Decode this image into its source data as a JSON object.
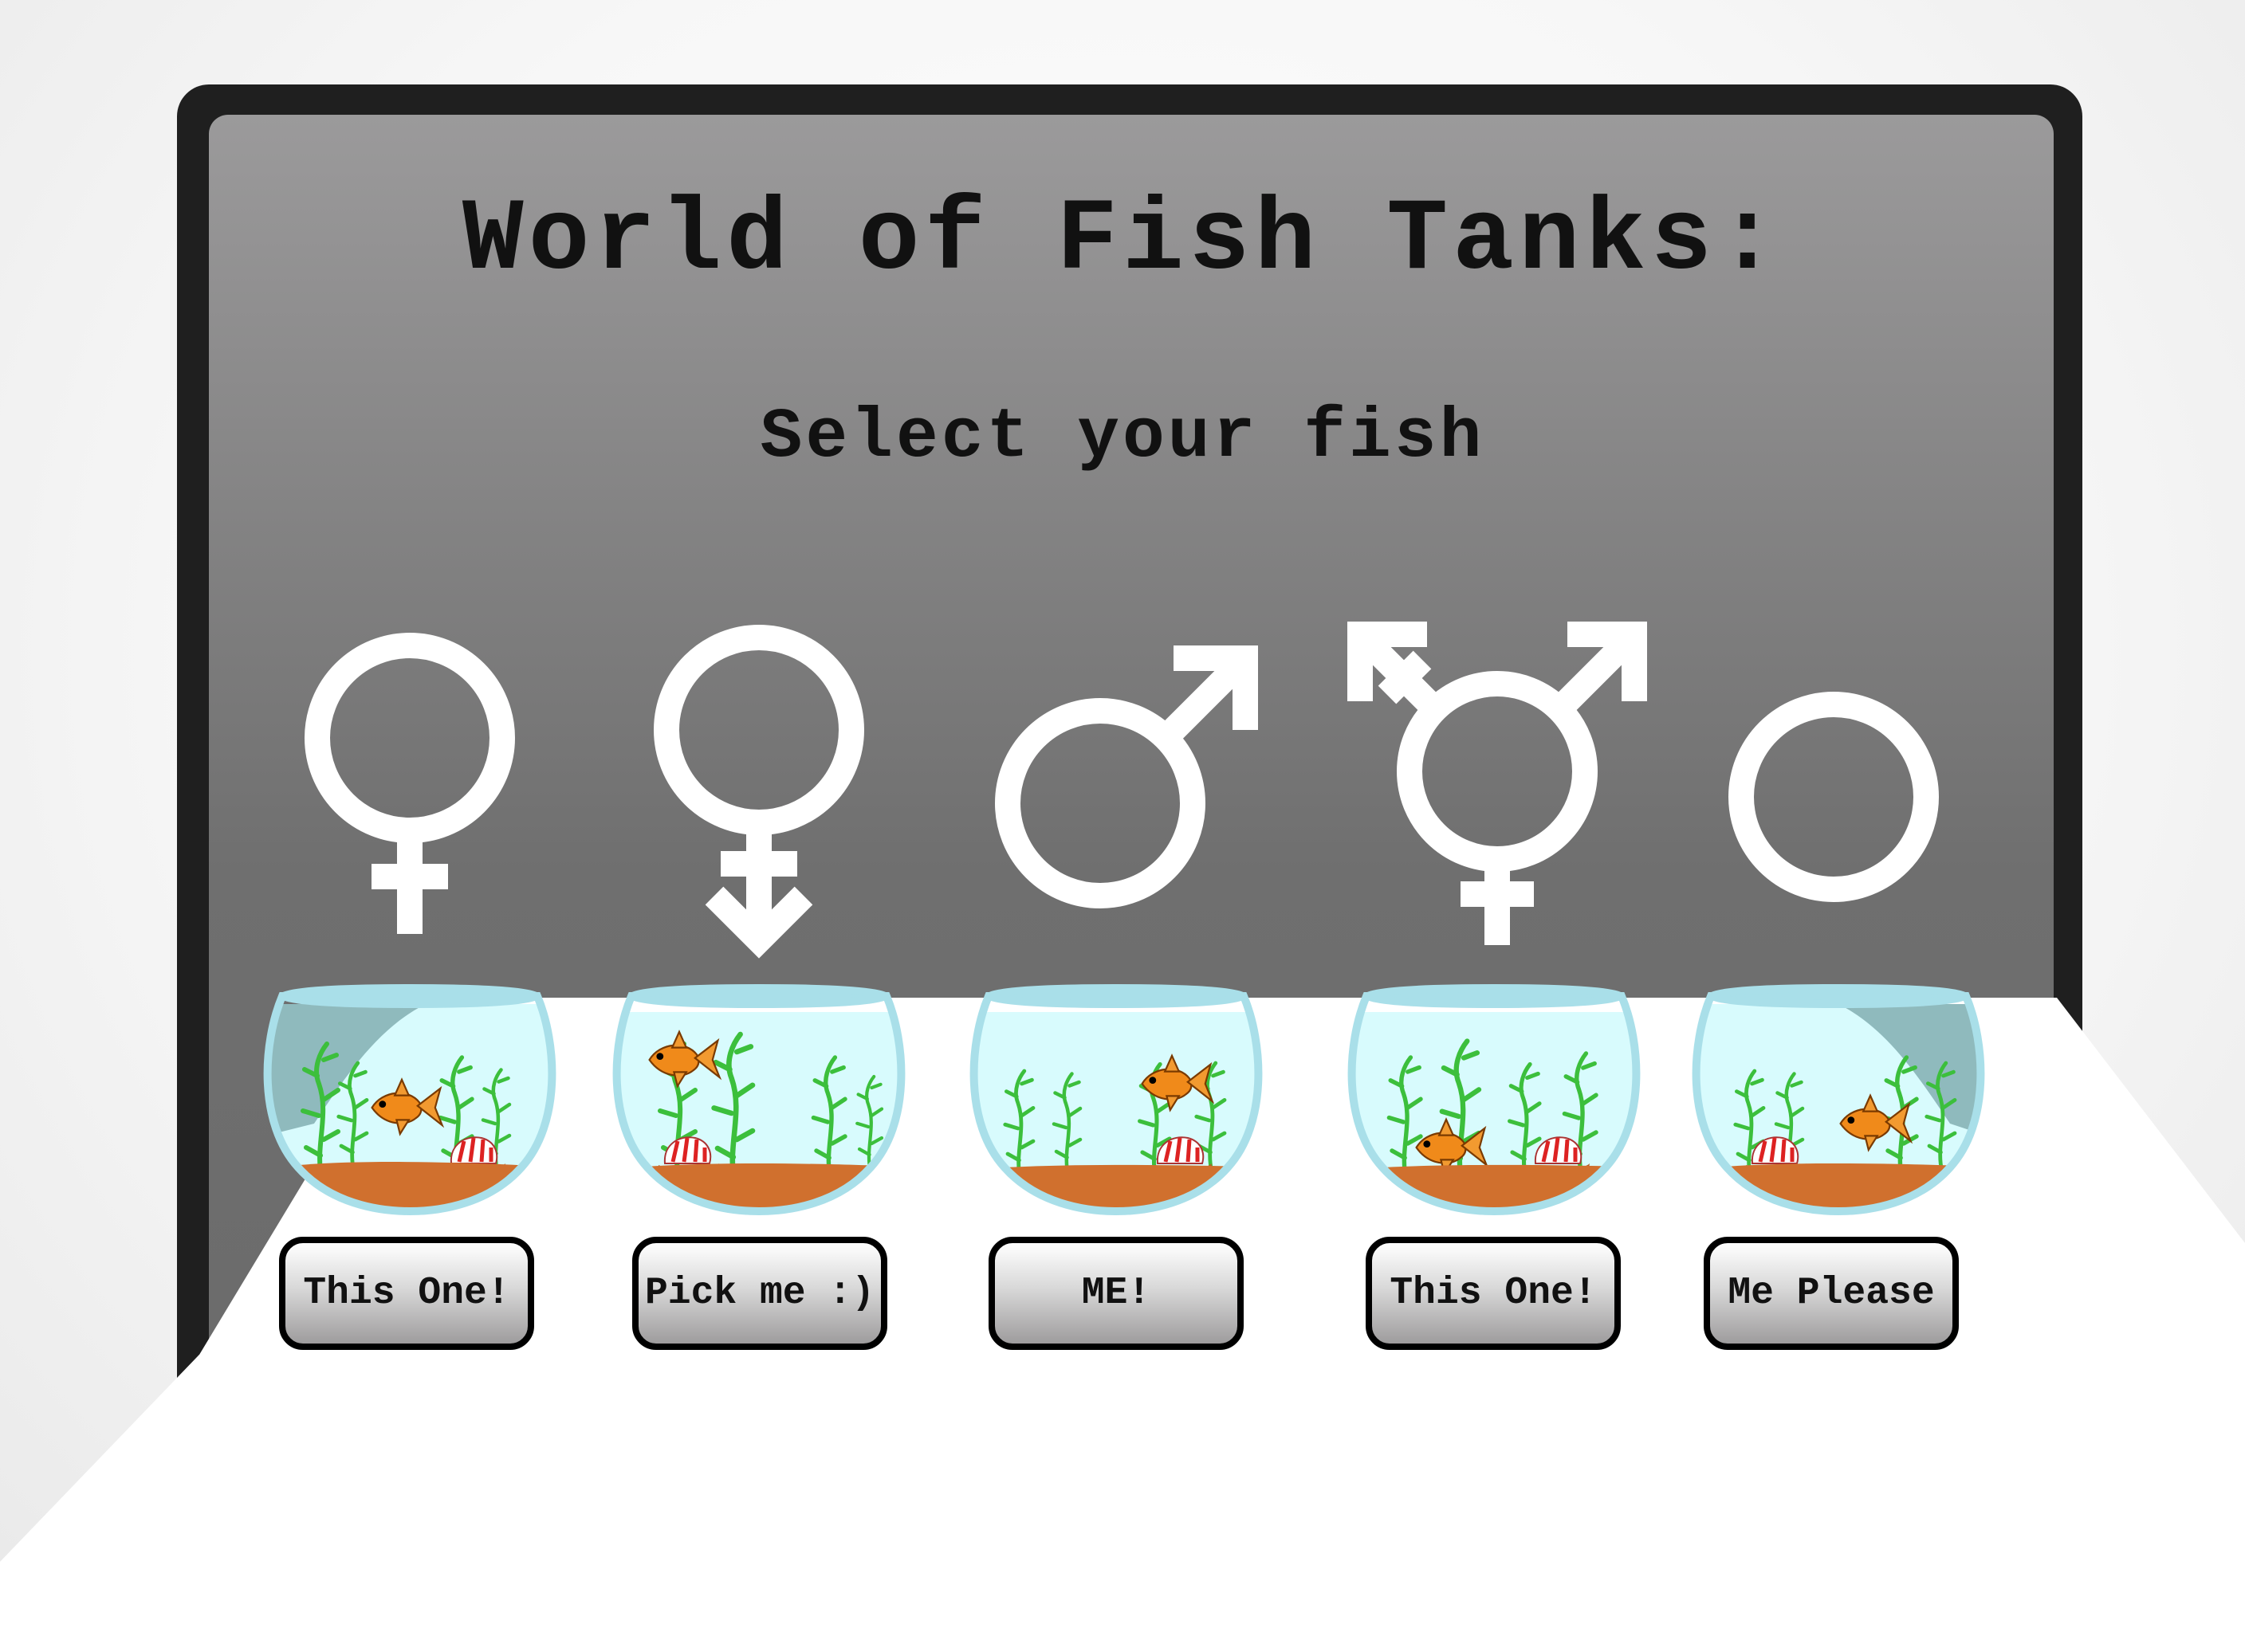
{
  "header": {
    "title": "World of Fish Tanks:",
    "subtitle": "Select your fish"
  },
  "colors": {
    "screen_top": "#9a999a",
    "screen_bottom": "#6b6b6b",
    "bezel": "#1f1f1f",
    "symbol": "#ffffff",
    "bowl_rim": "#a9dfe9",
    "water": "#d8fbfd",
    "gravel": "#d0702e",
    "plant": "#3fbf3f",
    "fish": "#f08a1a"
  },
  "options": [
    {
      "symbol": "female-symbol-icon",
      "button": "This One!"
    },
    {
      "symbol": "female-arrow-symbol-icon",
      "button": "Pick me :)"
    },
    {
      "symbol": "male-symbol-icon",
      "button": "ME!"
    },
    {
      "symbol": "transgender-symbol-icon",
      "button": "This One!"
    },
    {
      "symbol": "neutral-circle-symbol-icon",
      "button": "Me Please"
    }
  ]
}
